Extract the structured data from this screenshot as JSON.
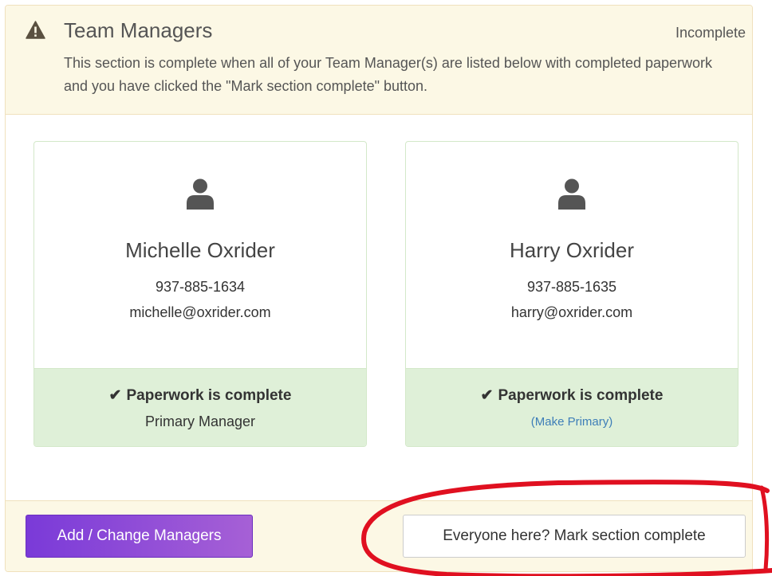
{
  "section": {
    "title": "Team Managers",
    "status": "Incomplete",
    "description": "This section is complete when all of your Team Manager(s) are listed below with completed paperwork and you have clicked the \"Mark section complete\" button.",
    "icon": "warning-icon"
  },
  "managers": [
    {
      "name": "Michelle Oxrider",
      "phone": "937-885-1634",
      "email": "michelle@oxrider.com",
      "paperwork_status": "Paperwork is complete",
      "role": "Primary Manager",
      "icon": "user-icon"
    },
    {
      "name": "Harry Oxrider",
      "phone": "937-885-1635",
      "email": "harry@oxrider.com",
      "paperwork_status": "Paperwork is complete",
      "action_link": "(Make Primary)",
      "icon": "user-icon"
    }
  ],
  "footer": {
    "add_button_label": "Add / Change Managers",
    "complete_button_label": "Everyone here? Mark section complete"
  },
  "colors": {
    "heading_bg": "#fcf8e5",
    "success_bg": "#dff0d8",
    "link": "#3e7eb8",
    "button_purple": "#7a3ad8",
    "annotation_red": "#e01020"
  }
}
